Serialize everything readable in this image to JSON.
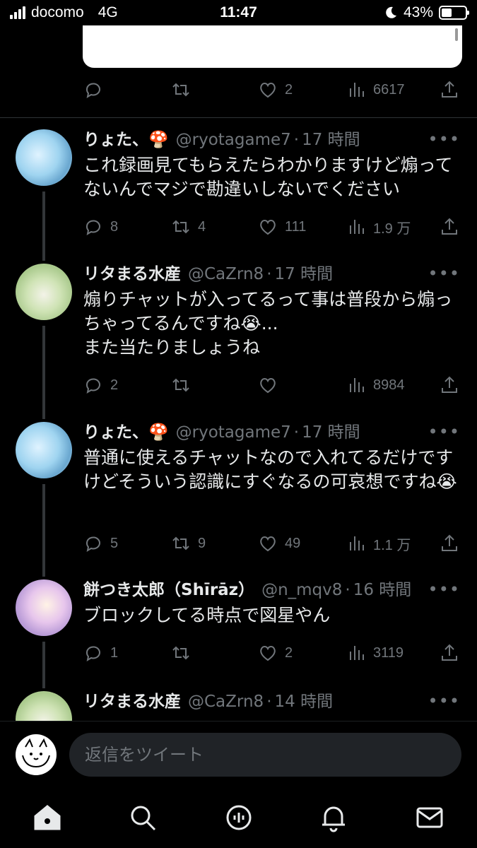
{
  "status_bar": {
    "carrier": "docomo",
    "network": "4G",
    "time": "11:47",
    "battery": "43%",
    "battery_level": 0.43
  },
  "top_actions": {
    "replies": "",
    "retweets": "",
    "likes": "2",
    "views": "6617"
  },
  "tweets": [
    {
      "name": "りょた、🍄",
      "handle": "@ryotagame7",
      "time": "17 時間",
      "text": "これ録画見てもらえたらわかりますけど煽ってないんでマジで勘違いしないでください",
      "replies": "8",
      "retweets": "4",
      "likes": "111",
      "views": "1.9 万",
      "avatar": "blue-hair-anime-avatar"
    },
    {
      "name": "リタまる水産",
      "handle": "@CaZrn8",
      "time": "17 時間",
      "text": "煽りチャットが入ってるって事は普段から煽っちゃってるんですね😭...\nまた当たりましょうね",
      "replies": "2",
      "retweets": "",
      "likes": "",
      "views": "8984",
      "avatar": "green-cat-avatar"
    },
    {
      "name": "りょた、🍄",
      "handle": "@ryotagame7",
      "time": "17 時間",
      "text": "普通に使えるチャットなので入れてるだけですけどそういう認識にすぐなるの可哀想ですね😭",
      "replies": "5",
      "retweets": "9",
      "likes": "49",
      "views": "1.1 万",
      "avatar": "blue-hair-anime-avatar"
    },
    {
      "name": "餅つき太郎（Shīrāz）",
      "handle": "@n_mqv8",
      "time": "16 時間",
      "text": "ブロックしてる時点で図星やん",
      "replies": "1",
      "retweets": "",
      "likes": "2",
      "views": "3119",
      "avatar": "purple-anime-avatar"
    },
    {
      "name": "リタまる水産",
      "handle": "@CaZrn8",
      "time": "14 時間",
      "text": "",
      "avatar": "green-cat-avatar"
    }
  ],
  "more_label": "•••",
  "reply_bar": {
    "placeholder": "返信をツイート"
  },
  "tab_bar": {
    "icons": [
      "home-icon",
      "search-icon",
      "spaces-icon",
      "notifications-icon",
      "messages-icon"
    ]
  },
  "colors": {
    "background": "#000000",
    "text": "#e7e9ea",
    "muted": "#71767b",
    "input_bg": "#202327"
  }
}
